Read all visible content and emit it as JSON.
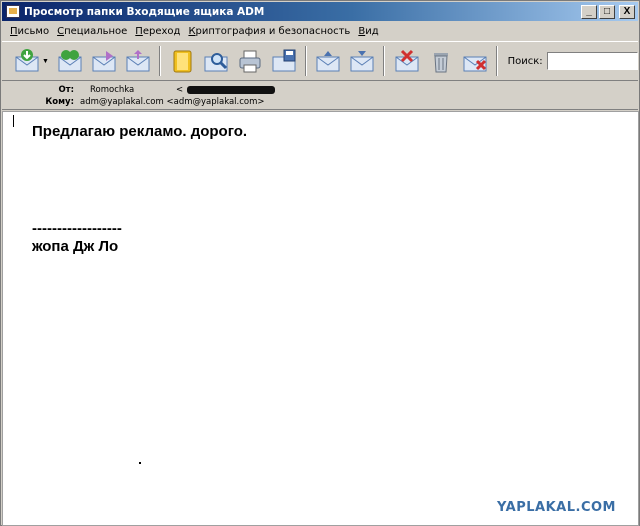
{
  "window": {
    "title": "Просмотр папки Входящие ящика ADM",
    "minimize": "_",
    "maximize": "□",
    "close": "X"
  },
  "menu": {
    "items": [
      {
        "acc": "П",
        "rest": "исьмо"
      },
      {
        "acc": "С",
        "rest": "пециальное"
      },
      {
        "acc": "П",
        "rest": "ереход"
      },
      {
        "acc": "К",
        "rest": "риптография и безопасность"
      },
      {
        "acc": "В",
        "rest": "ид"
      }
    ]
  },
  "toolbar": {
    "search_label": "Поиск:",
    "search_value": "",
    "icons": [
      "get-mail-icon",
      "reply-all-icon",
      "forward-icon",
      "compose-icon",
      "address-book-icon",
      "find-icon",
      "print-icon",
      "save-icon",
      "move-up-icon",
      "move-down-icon",
      "delete-message-icon",
      "trash-icon",
      "mark-spam-icon"
    ]
  },
  "header": {
    "from_label": "От:",
    "from_name": "Romochka",
    "from_email_prefix": "<",
    "to_label": "Кому:",
    "to_value": "adm@yaplakal.com <adm@yaplakal.com>"
  },
  "message": {
    "line1": "Предлагаю рекламо. дорого.",
    "signature_sep": "------------------",
    "signature": "жопа Дж Ло"
  },
  "watermark": "YAPLAKAL.COM",
  "colors": {
    "title_start": "#0a246a",
    "title_end": "#a6caf0",
    "watermark": "#3a6ea5"
  }
}
